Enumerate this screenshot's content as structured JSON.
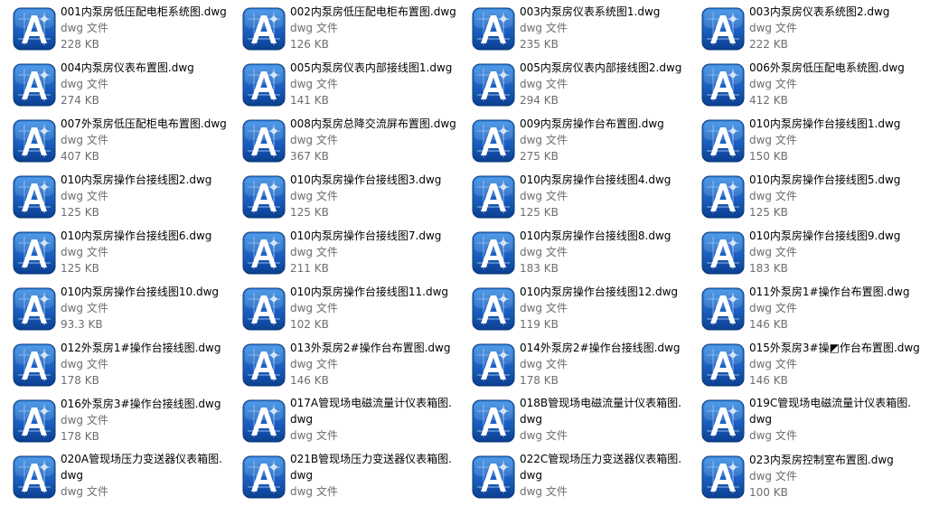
{
  "file_type_label": "dwg 文件",
  "icon": "autocad-dwg-icon",
  "colors": {
    "icon_dark": "#0b3f8f",
    "icon_light": "#2f86e0",
    "text": "#000000",
    "meta": "#6d6d6d"
  },
  "files": [
    {
      "name": "001内泵房低压配电柜系统图.dwg",
      "size": "228 KB"
    },
    {
      "name": "002内泵房低压配电柜布置图.dwg",
      "size": "126 KB"
    },
    {
      "name": "003内泵房仪表系统图1.dwg",
      "size": "235 KB"
    },
    {
      "name": "003内泵房仪表系统图2.dwg",
      "size": "222 KB"
    },
    {
      "name": "004内泵房仪表布置图.dwg",
      "size": "274 KB"
    },
    {
      "name": "005内泵房仪表内部接线图1.dwg",
      "size": "141 KB"
    },
    {
      "name": "005内泵房仪表内部接线图2.dwg",
      "size": "294 KB"
    },
    {
      "name": "006外泵房低压配电系统图.dwg",
      "size": "412 KB"
    },
    {
      "name": "007外泵房低压配柜电布置图.dwg",
      "size": "407 KB"
    },
    {
      "name": "008内泵房总降交流屏布置图.dwg",
      "size": "367 KB"
    },
    {
      "name": "009内泵房操作台布置图.dwg",
      "size": "275 KB"
    },
    {
      "name": "010内泵房操作台接线图1.dwg",
      "size": "150 KB"
    },
    {
      "name": "010内泵房操作台接线图2.dwg",
      "size": "125 KB"
    },
    {
      "name": "010内泵房操作台接线图3.dwg",
      "size": "125 KB"
    },
    {
      "name": "010内泵房操作台接线图4.dwg",
      "size": "125 KB"
    },
    {
      "name": "010内泵房操作台接线图5.dwg",
      "size": "125 KB"
    },
    {
      "name": "010内泵房操作台接线图6.dwg",
      "size": "125 KB"
    },
    {
      "name": "010内泵房操作台接线图7.dwg",
      "size": "211 KB"
    },
    {
      "name": "010内泵房操作台接线图8.dwg",
      "size": "183 KB"
    },
    {
      "name": "010内泵房操作台接线图9.dwg",
      "size": "183 KB"
    },
    {
      "name": "010内泵房操作台接线图10.dwg",
      "size": "93.3 KB"
    },
    {
      "name": "010内泵房操作台接线图11.dwg",
      "size": "102 KB"
    },
    {
      "name": "010内泵房操作台接线图12.dwg",
      "size": "119 KB"
    },
    {
      "name": "011外泵房1#操作台布置图.dwg",
      "size": "146 KB"
    },
    {
      "name": "012外泵房1#操作台接线图.dwg",
      "size": "178 KB"
    },
    {
      "name": "013外泵房2#操作台布置图.dwg",
      "size": "146 KB"
    },
    {
      "name": "014外泵房2#操作台接线图.dwg",
      "size": "178 KB"
    },
    {
      "name": "015外泵房3#操◩作台布置图.dwg",
      "size": "146 KB"
    },
    {
      "name": "016外泵房3#操作台接线图.dwg",
      "size": "178 KB"
    },
    {
      "name": "017A管现场电磁流量计仪表箱图.dwg",
      "size": ""
    },
    {
      "name": "018B管现场电磁流量计仪表箱图.dwg",
      "size": ""
    },
    {
      "name": "019C管现场电磁流量计仪表箱图.dwg",
      "size": ""
    },
    {
      "name": "020A管现场压力变送器仪表箱图.dwg",
      "size": ""
    },
    {
      "name": "021B管现场压力变送器仪表箱图.dwg",
      "size": ""
    },
    {
      "name": "022C管现场压力变送器仪表箱图.dwg",
      "size": ""
    },
    {
      "name": "023内泵房控制室布置图.dwg",
      "size": "100 KB"
    }
  ]
}
